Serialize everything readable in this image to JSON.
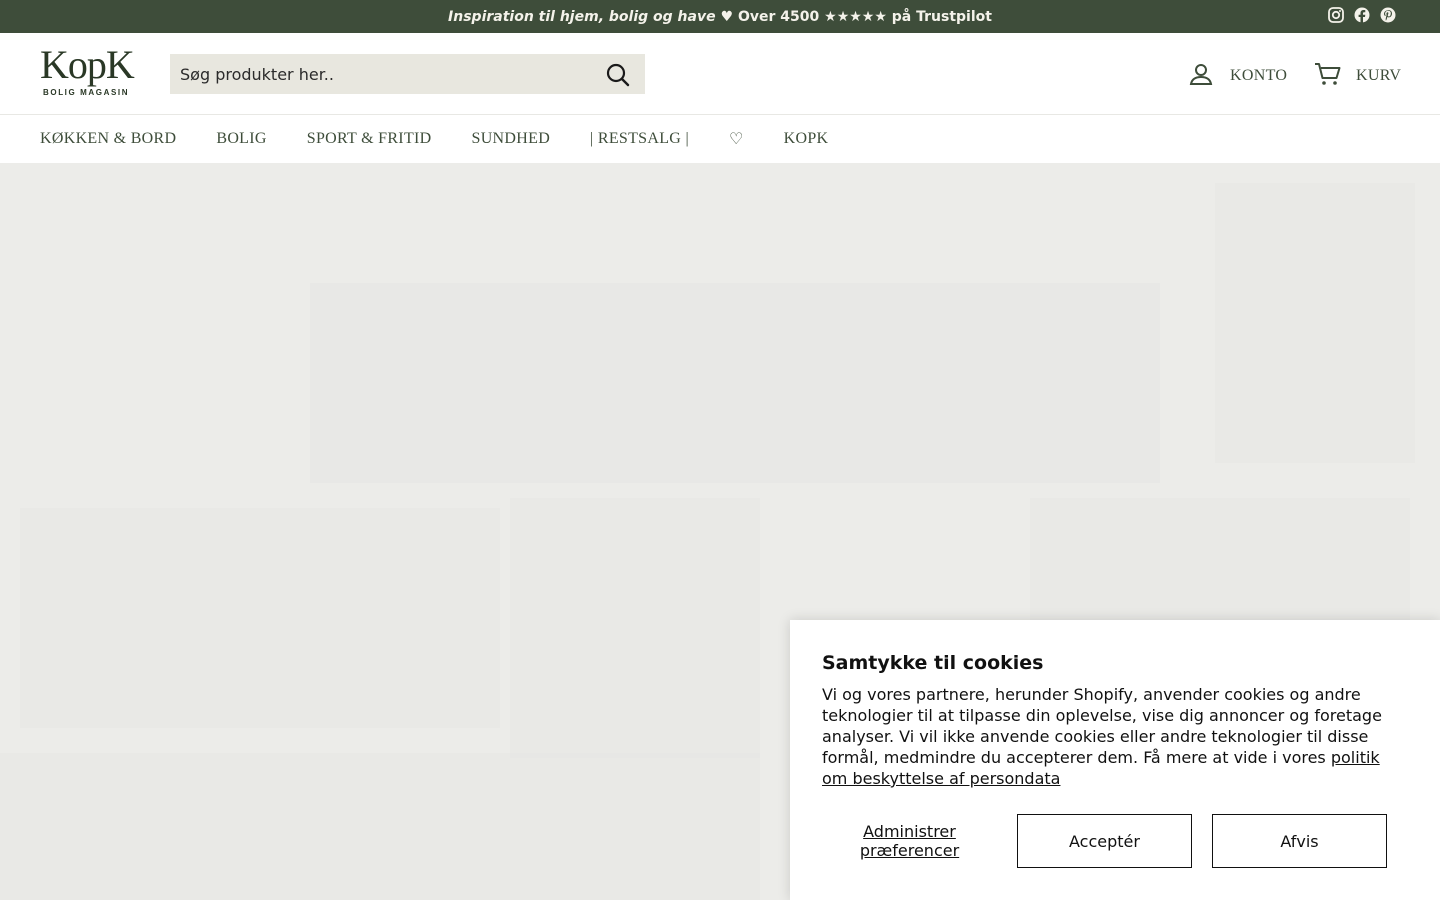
{
  "announcement": {
    "text_italic": "Inspiration til hjem, bolig og have",
    "text_rest": "♥ Over 4500 ★★★★★ på Trustpilot"
  },
  "social": [
    "instagram-icon",
    "facebook-icon",
    "pinterest-icon"
  ],
  "logo": {
    "word": "KopK",
    "tagline": "BOLIG MAGASIN"
  },
  "search": {
    "placeholder": "Søg produkter her..",
    "icon": "search-icon"
  },
  "header": {
    "account_label": "KONTO",
    "cart_label": "KURV"
  },
  "nav": {
    "items": [
      "KØKKEN & BORD",
      "BOLIG",
      "SPORT & FRITID",
      "SUNDHED",
      "| RESTSALG |",
      "♡",
      "KOPK"
    ]
  },
  "colors": {
    "brand_green": "#3e4d3a",
    "search_bg": "#e8e7df",
    "hero_bg": "#ecece9"
  },
  "cookie": {
    "title": "Samtykke til cookies",
    "body": "Vi og vores partnere, herunder Shopify, anvender cookies og andre teknologier til at tilpasse din oplevelse, vise dig annoncer og foretage analyser. Vi vil ikke anvende cookies eller andre teknologier til disse formål, medmindre du accepterer dem. Få mere at vide i vores",
    "link_text": "politik om beskyttelse af persondata",
    "preferences_label": "Administrer præferencer",
    "accept_label": "Acceptér",
    "reject_label": "Afvis"
  }
}
